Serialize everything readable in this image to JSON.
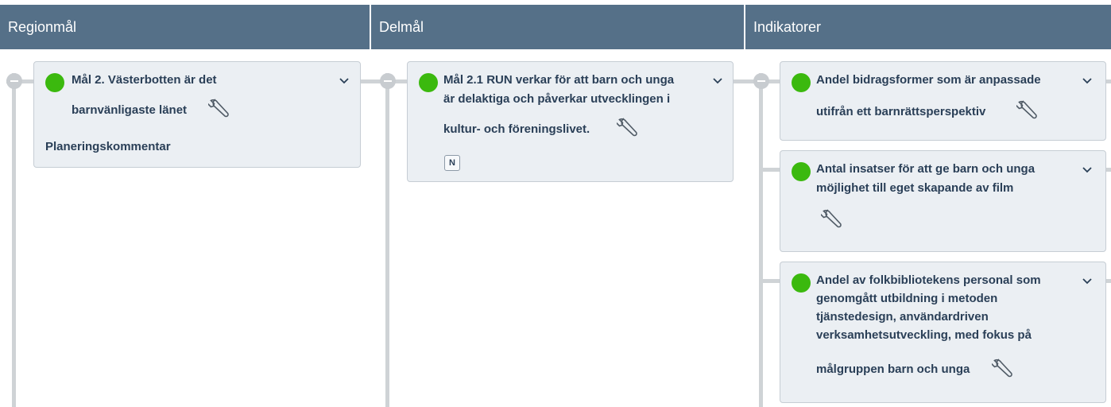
{
  "columns": {
    "regionmal": "Regionmål",
    "delmal": "Delmål",
    "indikatorer": "Indikatorer"
  },
  "region_card": {
    "title_line1": "Mål 2. Västerbotten är det",
    "title_line2": "barnvänligaste länet",
    "comment_label": "Planeringskommentar",
    "status_color": "#3bb90e",
    "icons": [
      "status-dot",
      "chevron-down-icon",
      "wrench-icon"
    ]
  },
  "delmal_card": {
    "title_line1": "Mål 2.1 RUN verkar för att barn och unga",
    "title_line2": "är delaktiga och påverkar utvecklingen i",
    "title_line3": "kultur- och föreningslivet.",
    "badge": "N",
    "status_color": "#3bb90e"
  },
  "indicators": [
    {
      "line1": "Andel bidragsformer som är anpassade",
      "line2": "utifrån ett barnrättsperspektiv",
      "status_color": "#3bb90e"
    },
    {
      "line1": "Antal insatser för att ge barn och unga",
      "line2": "möjlighet till eget skapande av film",
      "status_color": "#3bb90e"
    },
    {
      "line1": "Andel av folkbibliotekens personal som",
      "line2": "genomgått utbildning i metoden",
      "line3": "tjänstedesign, användardriven",
      "line4": "verksamhetsutveckling, med fokus på",
      "line5": "målgruppen barn och unga",
      "status_color": "#3bb90e"
    }
  ],
  "colors": {
    "header_bg": "#557088",
    "card_bg": "#ebeff3",
    "connector": "#cfd3d6",
    "status_green": "#3bb90e"
  }
}
